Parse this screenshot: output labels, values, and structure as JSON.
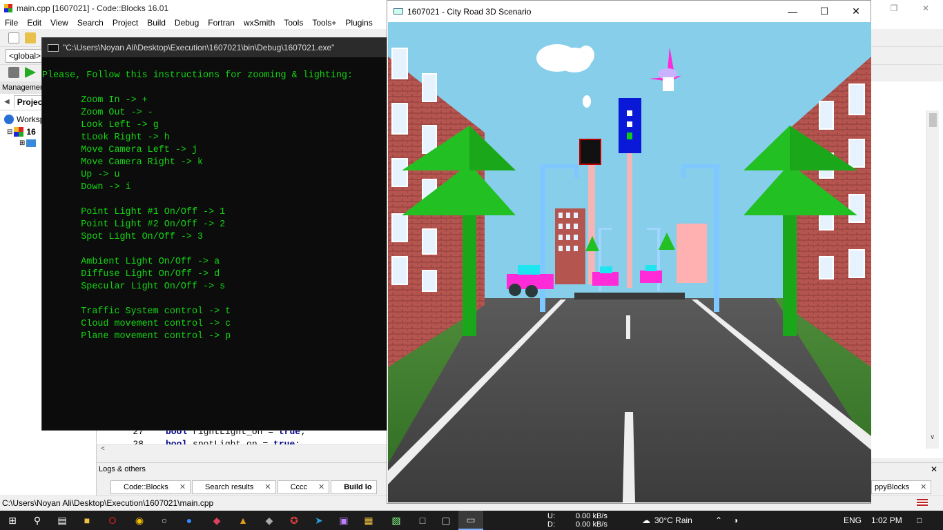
{
  "ide": {
    "title": "main.cpp [1607021] - Code::Blocks 16.01",
    "menu": [
      "File",
      "Edit",
      "View",
      "Search",
      "Project",
      "Build",
      "Debug",
      "Fortran",
      "wxSmith",
      "Tools",
      "Tools+",
      "Plugins"
    ],
    "global_combo": "<global>",
    "management_label": "Management",
    "projects_tab": "Projects",
    "tree_workspace": "Workspace",
    "tree_project": "16",
    "code_lines": [
      {
        "num": "27",
        "text_kw": "bool",
        "text_rest": " rightLight_on = ",
        "text_val": "true",
        "text_end": ";"
      },
      {
        "num": "28",
        "text_kw": "bool",
        "text_rest": " spotLight_on = ",
        "text_val": "true",
        "text_end": ";"
      }
    ],
    "logs_label": "Logs & others",
    "log_tabs": [
      "Code::Blocks",
      "Search results",
      "Cccc",
      "Build lo"
    ],
    "right_tab": "ppyBlocks",
    "status_path": "C:\\Users\\Noyan Ali\\Desktop\\Execution\\1607021\\main.cpp"
  },
  "console": {
    "title": "\"C:\\Users\\Noyan Ali\\Desktop\\Execution\\1607021\\bin\\Debug\\1607021.exe\"",
    "lines": [
      "Please, Follow this instructions for zooming & lighting:",
      "",
      "       Zoom In -> +",
      "       Zoom Out -> -",
      "       Look Left -> g",
      "       tLook Right -> h",
      "       Move Camera Left -> j",
      "       Move Camera Right -> k",
      "       Up -> u",
      "       Down -> i",
      "",
      "       Point Light #1 On/Off -> 1",
      "       Point Light #2 On/Off -> 2",
      "       Spot Light On/Off -> 3",
      "",
      "       Ambient Light On/Off -> a",
      "       Diffuse Light On/Off -> d",
      "       Specular Light On/Off -> s",
      "",
      "       Traffic System control -> t",
      "       Cloud movement control -> c",
      "       Plane movement control -> p"
    ]
  },
  "game": {
    "title": "1607021 - City Road 3D Scenario",
    "colors": {
      "sky": "#87ceeb",
      "brick": "#b5554f",
      "tree": "#22c022",
      "road": "#4a4a4a",
      "grass": "#3d7a2a",
      "car": "#ff2ad8"
    }
  },
  "taskbar": {
    "net_up_label": "U:",
    "net_down_label": "D:",
    "net_up": "0.00 kB/s",
    "net_down": "0.00 kB/s",
    "weather": "30°C  Rain",
    "lang": "ENG",
    "time": "1:02 PM"
  }
}
